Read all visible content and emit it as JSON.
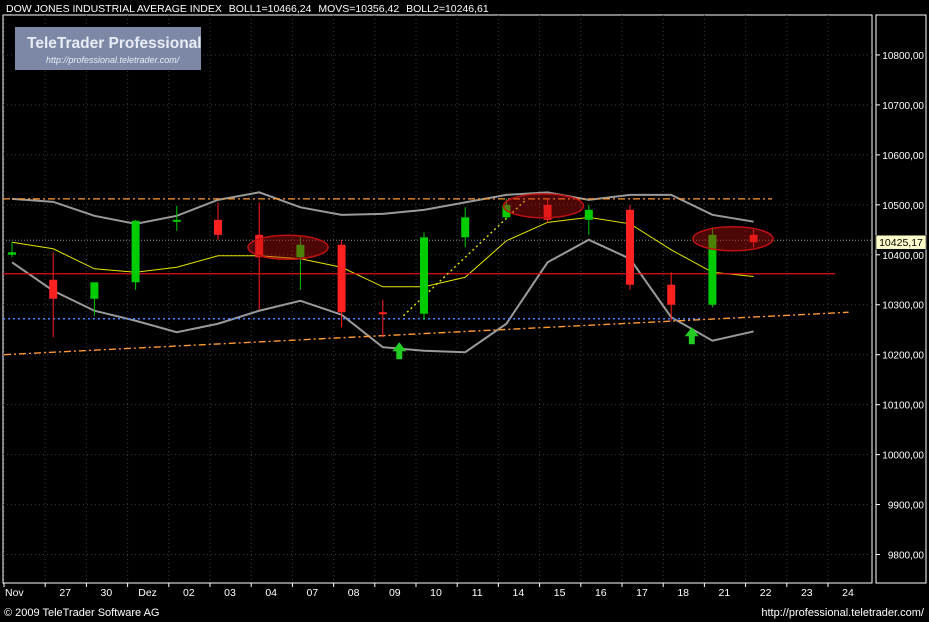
{
  "header": {
    "instrument": "DOW JONES INDUSTRIAL AVERAGE INDEX",
    "boll1": "BOLL1=10466,24",
    "movs": "MOVS=10356,42",
    "boll2": "BOLL2=10246,61"
  },
  "watermark": {
    "title": "TeleTrader Professional",
    "url": "http://professional.teletrader.com/"
  },
  "footer": {
    "copyright": "© 2009 TeleTrader Software AG",
    "url": "http://professional.teletrader.com/"
  },
  "colors": {
    "background": "#000000",
    "plot_frame": "#ffffff",
    "grid": "#3a3a3a",
    "candle_up": "#00cc00",
    "candle_down": "#ff2020",
    "bollinger": "#9a9a9a",
    "moving_average": "#e6e600",
    "support_line": "#e01010",
    "trend_line": "#ff9933",
    "dotted_level": "#4a7fff",
    "arrow": "#22cc22",
    "highlight": "#c01010",
    "price_tag_bg": "#ffffcc"
  },
  "chart_data": {
    "type": "candlestick",
    "y_axis_ticks": [
      "10800,00",
      "10700,00",
      "10600,00",
      "10500,00",
      "10400,00",
      "10300,00",
      "10200,00",
      "10100,00",
      "10000,00",
      "9900,00",
      "9800,00"
    ],
    "y_axis_tick_values": [
      10800,
      10700,
      10600,
      10500,
      10400,
      10300,
      10200,
      10100,
      10000,
      9900,
      9800
    ],
    "x_axis_labels": [
      "Nov",
      "27",
      "30",
      "Dez",
      "02",
      "03",
      "04",
      "07",
      "08",
      "09",
      "10",
      "11",
      "14",
      "15",
      "16",
      "17",
      "18",
      "21",
      "22",
      "23",
      "24"
    ],
    "ylim": [
      9743,
      10880
    ],
    "last_price": "10425,17",
    "last_value": 10425.17,
    "sessions": [
      {
        "date": "26 Nov",
        "open": 10400,
        "high": 10425,
        "low": 10395,
        "close": 10405,
        "ma": 10425,
        "bb_up": 10512,
        "bb_dn": 10385
      },
      {
        "date": "27 Nov",
        "open": 10350,
        "high": 10405,
        "low": 10235,
        "close": 10312,
        "ma": 10412,
        "bb_up": 10506,
        "bb_dn": 10328
      },
      {
        "date": "30 Nov",
        "open": 10312,
        "high": 10340,
        "low": 10278,
        "close": 10345,
        "ma": 10372,
        "bb_up": 10478,
        "bb_dn": 10288
      },
      {
        "date": "01 Dec",
        "open": 10345,
        "high": 10470,
        "low": 10330,
        "close": 10468,
        "ma": 10365,
        "bb_up": 10462,
        "bb_dn": 10268
      },
      {
        "date": "02 Dec",
        "open": 10468,
        "high": 10498,
        "low": 10448,
        "close": 10470,
        "ma": 10375,
        "bb_up": 10478,
        "bb_dn": 10245
      },
      {
        "date": "03 Dec",
        "open": 10470,
        "high": 10505,
        "low": 10430,
        "close": 10440,
        "ma": 10398,
        "bb_up": 10510,
        "bb_dn": 10262
      },
      {
        "date": "04 Dec",
        "open": 10440,
        "high": 10505,
        "low": 10290,
        "close": 10395,
        "ma": 10398,
        "bb_up": 10525,
        "bb_dn": 10288
      },
      {
        "date": "07 Dec",
        "open": 10395,
        "high": 10435,
        "low": 10330,
        "close": 10420,
        "ma": 10392,
        "bb_up": 10495,
        "bb_dn": 10308
      },
      {
        "date": "08 Dec",
        "open": 10420,
        "high": 10430,
        "low": 10255,
        "close": 10285,
        "ma": 10375,
        "bb_up": 10480,
        "bb_dn": 10280
      },
      {
        "date": "09 Dec",
        "open": 10285,
        "high": 10310,
        "low": 10235,
        "close": 10282,
        "ma": 10336,
        "bb_up": 10482,
        "bb_dn": 10215
      },
      {
        "date": "10 Dec",
        "open": 10282,
        "high": 10445,
        "low": 10270,
        "close": 10435,
        "ma": 10336,
        "bb_up": 10490,
        "bb_dn": 10208
      },
      {
        "date": "11 Dec",
        "open": 10435,
        "high": 10495,
        "low": 10415,
        "close": 10475,
        "ma": 10355,
        "bb_up": 10505,
        "bb_dn": 10205
      },
      {
        "date": "14 Dec",
        "open": 10475,
        "high": 10512,
        "low": 10470,
        "close": 10500,
        "ma": 10428,
        "bb_up": 10520,
        "bb_dn": 10262
      },
      {
        "date": "15 Dec",
        "open": 10500,
        "high": 10512,
        "low": 10465,
        "close": 10470,
        "ma": 10465,
        "bb_up": 10525,
        "bb_dn": 10385
      },
      {
        "date": "16 Dec",
        "open": 10470,
        "high": 10500,
        "low": 10440,
        "close": 10490,
        "ma": 10475,
        "bb_up": 10510,
        "bb_dn": 10430
      },
      {
        "date": "17 Dec",
        "open": 10490,
        "high": 10500,
        "low": 10330,
        "close": 10340,
        "ma": 10462,
        "bb_up": 10520,
        "bb_dn": 10392
      },
      {
        "date": "18 Dec",
        "open": 10340,
        "high": 10365,
        "low": 10268,
        "close": 10300,
        "ma": 10410,
        "bb_up": 10520,
        "bb_dn": 10275
      },
      {
        "date": "21 Dec",
        "open": 10300,
        "high": 10455,
        "low": 10295,
        "close": 10440,
        "ma": 10365,
        "bb_up": 10480,
        "bb_dn": 10228
      },
      {
        "date": "22 Dec",
        "open": 10440,
        "high": 10450,
        "low": 10415,
        "close": 10425.17,
        "ma": 10356.42,
        "bb_up": 10466.24,
        "bb_dn": 10246.61
      }
    ],
    "annotations": {
      "resistance_level": 10512,
      "support_level": 10362,
      "dotted_level": 10429,
      "blue_dotted_level": 10272,
      "trend_from": {
        "index": 0,
        "value": 10200
      },
      "trend_to": {
        "index": 20.5,
        "value": 10285
      },
      "dotted_trend_from": {
        "index": 9.5,
        "value": 10278
      },
      "dotted_trend_to": {
        "index": 12.5,
        "value": 10512
      },
      "arrows": [
        {
          "index": 9.4,
          "value": 10205
        },
        {
          "index": 16.5,
          "value": 10235
        }
      ],
      "ellipses": [
        {
          "index": 6.7,
          "value": 10415
        },
        {
          "index": 12.9,
          "value": 10498
        },
        {
          "index": 17.5,
          "value": 10432
        }
      ]
    }
  }
}
